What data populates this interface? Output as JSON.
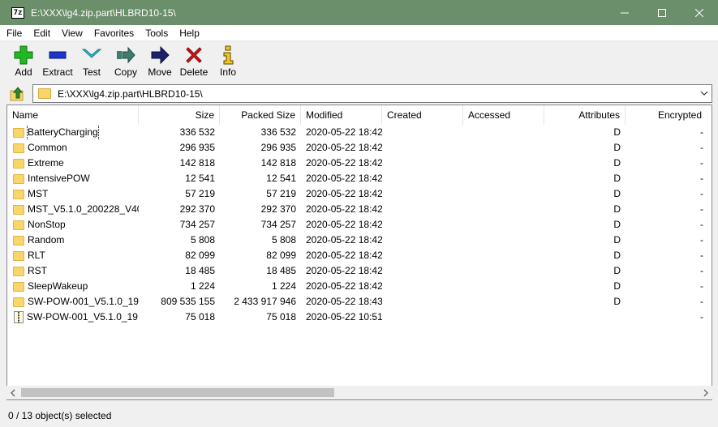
{
  "window": {
    "title": "E:\\XXX\\lg4.zip.part\\HLBRD10-15\\",
    "app_icon_text": "7z",
    "minimize": "—",
    "maximize": "☐",
    "close": "✕"
  },
  "menu": [
    "File",
    "Edit",
    "View",
    "Favorites",
    "Tools",
    "Help"
  ],
  "toolbar": [
    {
      "label": "Add",
      "icon": "plus-icon"
    },
    {
      "label": "Extract",
      "icon": "minus-icon"
    },
    {
      "label": "Test",
      "icon": "test-icon"
    },
    {
      "label": "Copy",
      "icon": "copy-arrow-icon"
    },
    {
      "label": "Move",
      "icon": "move-arrow-icon"
    },
    {
      "label": "Delete",
      "icon": "delete-x-icon"
    },
    {
      "label": "Info",
      "icon": "info-icon"
    }
  ],
  "address": {
    "path": "E:\\XXX\\lg4.zip.part\\HLBRD10-15\\"
  },
  "columns": [
    "Name",
    "Size",
    "Packed Size",
    "Modified",
    "Created",
    "Accessed",
    "Attributes",
    "Encrypted"
  ],
  "rows": [
    {
      "name": "BatteryCharging",
      "type": "folder",
      "size": "336 532",
      "packed": "336 532",
      "modified": "2020-05-22 18:42",
      "created": "",
      "accessed": "",
      "attr": "D",
      "enc": "-"
    },
    {
      "name": "Common",
      "type": "folder",
      "size": "296 935",
      "packed": "296 935",
      "modified": "2020-05-22 18:42",
      "created": "",
      "accessed": "",
      "attr": "D",
      "enc": "-"
    },
    {
      "name": "Extreme",
      "type": "folder",
      "size": "142 818",
      "packed": "142 818",
      "modified": "2020-05-22 18:42",
      "created": "",
      "accessed": "",
      "attr": "D",
      "enc": "-"
    },
    {
      "name": "IntensivePOW",
      "type": "folder",
      "size": "12 541",
      "packed": "12 541",
      "modified": "2020-05-22 18:42",
      "created": "",
      "accessed": "",
      "attr": "D",
      "enc": "-"
    },
    {
      "name": "MST",
      "type": "folder",
      "size": "57 219",
      "packed": "57 219",
      "modified": "2020-05-22 18:42",
      "created": "",
      "accessed": "",
      "attr": "D",
      "enc": "-"
    },
    {
      "name": "MST_V5.1.0_200228_V40...",
      "type": "folder",
      "size": "292 370",
      "packed": "292 370",
      "modified": "2020-05-22 18:42",
      "created": "",
      "accessed": "",
      "attr": "D",
      "enc": "-"
    },
    {
      "name": "NonStop",
      "type": "folder",
      "size": "734 257",
      "packed": "734 257",
      "modified": "2020-05-22 18:42",
      "created": "",
      "accessed": "",
      "attr": "D",
      "enc": "-"
    },
    {
      "name": "Random",
      "type": "folder",
      "size": "5 808",
      "packed": "5 808",
      "modified": "2020-05-22 18:42",
      "created": "",
      "accessed": "",
      "attr": "D",
      "enc": "-"
    },
    {
      "name": "RLT",
      "type": "folder",
      "size": "82 099",
      "packed": "82 099",
      "modified": "2020-05-22 18:42",
      "created": "",
      "accessed": "",
      "attr": "D",
      "enc": "-"
    },
    {
      "name": "RST",
      "type": "folder",
      "size": "18 485",
      "packed": "18 485",
      "modified": "2020-05-22 18:42",
      "created": "",
      "accessed": "",
      "attr": "D",
      "enc": "-"
    },
    {
      "name": "SleepWakeup",
      "type": "folder",
      "size": "1 224",
      "packed": "1 224",
      "modified": "2020-05-22 18:42",
      "created": "",
      "accessed": "",
      "attr": "D",
      "enc": "-"
    },
    {
      "name": "SW-POW-001_V5.1.0_19...",
      "type": "folder",
      "size": "809 535 155",
      "packed": "2 433 917 946",
      "modified": "2020-05-22 18:43",
      "created": "",
      "accessed": "",
      "attr": "D",
      "enc": "-"
    },
    {
      "name": "SW-POW-001_V5.1.0_19...",
      "type": "zip",
      "size": "75 018",
      "packed": "75 018",
      "modified": "2020-05-22 10:51",
      "created": "",
      "accessed": "",
      "attr": "",
      "enc": "-"
    }
  ],
  "status": {
    "text": "0 / 13 object(s) selected"
  }
}
